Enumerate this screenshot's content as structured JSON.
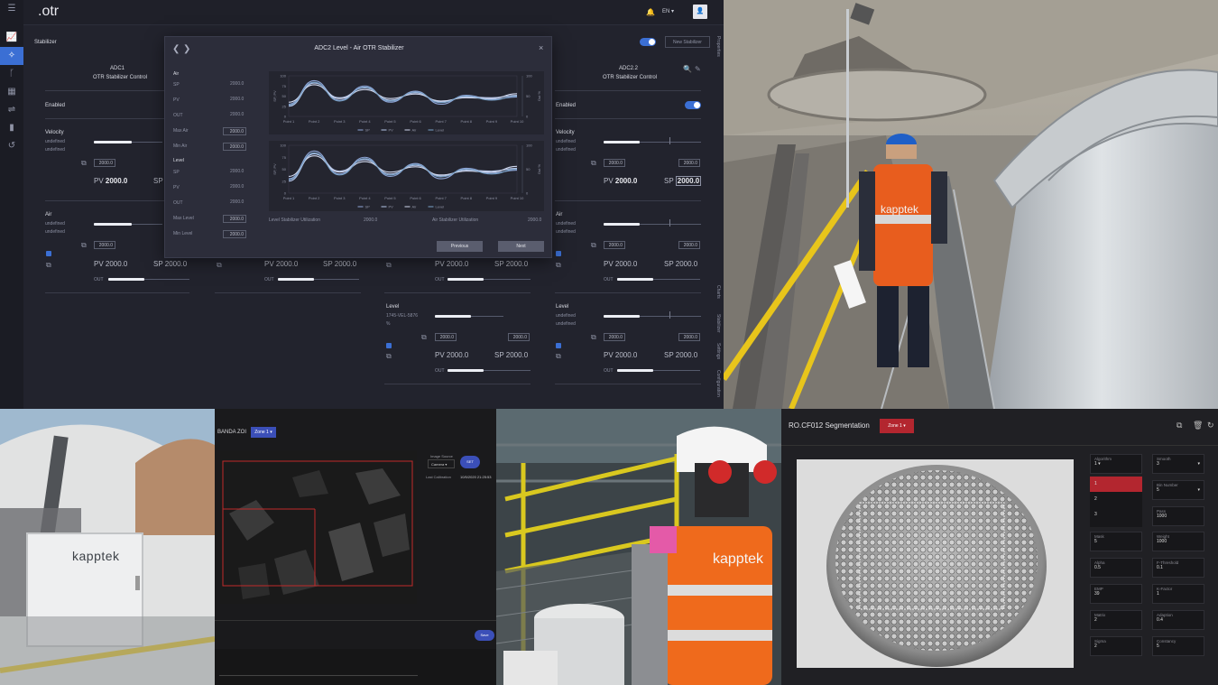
{
  "otr_app": {
    "logo": ".otr",
    "language": "EN",
    "page": "Stabilizer",
    "new_stabilizer_label": "New Stabilizer",
    "side_tabs": [
      "Properties",
      "Charts",
      "Stabilizer",
      "Settings",
      "Configuration"
    ],
    "left_panel": {
      "title": "ADC1",
      "subtitle": "OTR Stabilizer Control",
      "enabled_label": "Enabled",
      "velocity_label": "Velocity",
      "undefined_1": "undefined",
      "undefined_2": "undefined",
      "velocity_box": "2000.0",
      "pv_label": "PV",
      "pv_value": "2000.0",
      "sp_label": "SP",
      "air_label": "Air",
      "air_box": "2000.0",
      "air_pv": "PV 2000.0",
      "air_sp": "SP 2000.0",
      "out_label": "OUT"
    },
    "mid_row": {
      "pv": "PV 2000.0",
      "sp": "SP 2000.0",
      "out_label": "OUT"
    },
    "level_panel": {
      "label": "Level",
      "tag": "1745-VEL-5876",
      "unit": "%",
      "box1": "2000.0",
      "box2": "2000.0",
      "pv": "PV 2000.0",
      "sp": "SP 2000.0",
      "out_label": "OUT"
    },
    "right_panel": {
      "title": "ADC2.2",
      "subtitle": "OTR Stabilizer Control",
      "enabled_label": "Enabled",
      "velocity_label": "Velocity",
      "undefined_1": "undefined",
      "undefined_2": "undefined",
      "box1": "2000.0",
      "box2": "2000.0",
      "pv_label": "PV",
      "pv_value": "2000.0",
      "sp_label": "SP",
      "sp_value": "2000.0",
      "air_label": "Air",
      "air_box1": "2000.0",
      "air_box2": "2000.0",
      "air_pv": "PV 2000.0",
      "air_sp": "SP 2000.0",
      "out_label": "OUT",
      "level_label": "Level",
      "level_box1": "2000.0",
      "level_box2": "2000.0",
      "level_pv": "PV 2000.0",
      "level_sp": "SP 2000.0",
      "level_out": "OUT"
    },
    "modal": {
      "title": "ADC2 Level - Air OTR Stabilizer",
      "air_label": "Air",
      "level_label": "Level",
      "rows_air": [
        {
          "label": "SP",
          "value": "2000.0"
        },
        {
          "label": "PV",
          "value": "2000.0"
        },
        {
          "label": "OUT",
          "value": "2000.0"
        },
        {
          "label": "Max Air",
          "value": "2000.0"
        },
        {
          "label": "Min Air",
          "value": "2000.0"
        }
      ],
      "rows_level": [
        {
          "label": "SP",
          "value": "2000.0"
        },
        {
          "label": "PV",
          "value": "2000.0"
        },
        {
          "label": "OUT",
          "value": "2000.0"
        },
        {
          "label": "Max Level",
          "value": "2000.0"
        },
        {
          "label": "Min Level",
          "value": "2000.0"
        }
      ],
      "level_util_label": "Level Stabilizer Utilization",
      "level_util_value": "2000.0",
      "air_util_label": "Air Stabilizer Utilization",
      "air_util_value": "2000.0",
      "previous_label": "Previous",
      "next_label": "Next"
    }
  },
  "chart_data": [
    {
      "type": "line",
      "x": [
        "Point 1",
        "Point 2",
        "Point 3",
        "Point 4",
        "Point 5",
        "Point 6",
        "Point 7",
        "Point 8",
        "Point 9",
        "Point 10"
      ],
      "ylim": [
        0,
        100
      ],
      "ylabel": "SP, PV",
      "y2label": "Out %",
      "y_ticks": [
        "100",
        "75",
        "50",
        "25",
        "0"
      ],
      "y2_ticks": [
        "100",
        "50",
        "0"
      ],
      "series": [
        {
          "name": "SP",
          "color": "#8fa6d8",
          "values": [
            30,
            88,
            40,
            75,
            35,
            62,
            30,
            52,
            42,
            48
          ]
        },
        {
          "name": "PV",
          "color": "#b6c6ea",
          "values": [
            25,
            82,
            46,
            70,
            40,
            58,
            36,
            48,
            46,
            52
          ]
        },
        {
          "name": "Air",
          "color": "#d0d8ee",
          "values": [
            35,
            78,
            44,
            66,
            44,
            55,
            38,
            46,
            44,
            56
          ]
        },
        {
          "name": "Level",
          "color": "#7aa2c8",
          "values": [
            28,
            84,
            38,
            72,
            38,
            60,
            34,
            50,
            40,
            50
          ]
        }
      ],
      "legend": [
        "SP",
        "PV",
        "Air",
        "Level"
      ]
    },
    {
      "type": "line",
      "x": [
        "Point 1",
        "Point 2",
        "Point 3",
        "Point 4",
        "Point 5",
        "Point 6",
        "Point 7",
        "Point 8",
        "Point 9",
        "Point 10"
      ],
      "ylim": [
        0,
        100
      ],
      "ylabel": "SP, PV",
      "y2label": "Out %",
      "y_ticks": [
        "100",
        "75",
        "50",
        "25",
        "0"
      ],
      "y2_ticks": [
        "100",
        "50",
        "0"
      ],
      "series": [
        {
          "name": "SP",
          "color": "#8fa6d8",
          "values": [
            30,
            88,
            40,
            75,
            35,
            62,
            30,
            52,
            42,
            48
          ]
        },
        {
          "name": "PV",
          "color": "#b6c6ea",
          "values": [
            25,
            82,
            46,
            70,
            40,
            58,
            36,
            48,
            46,
            52
          ]
        },
        {
          "name": "Air",
          "color": "#d0d8ee",
          "values": [
            35,
            78,
            44,
            66,
            44,
            55,
            38,
            46,
            44,
            56
          ]
        },
        {
          "name": "Level",
          "color": "#7aa2c8",
          "values": [
            28,
            84,
            38,
            72,
            38,
            60,
            34,
            50,
            40,
            50
          ]
        }
      ],
      "legend": [
        "SP",
        "PV",
        "Air",
        "Level"
      ]
    }
  ],
  "banda_app": {
    "title": "BANDA ZOI",
    "zone_label": "Zone 1",
    "image_source_label": "Image Source",
    "image_source_value": "Camera",
    "set_label": "SET",
    "last_calibration_label": "Last Calibration",
    "last_calibration_value": "10/5/2020 21:25:53",
    "save_label": "Save"
  },
  "segmentation_app": {
    "title": "RO.CF012 Segmentation",
    "zone_label": "Zone 1",
    "algorithm_label": "Algorithm",
    "algorithm_value": "1",
    "algorithm_options": [
      "1",
      "2",
      "3"
    ],
    "fields": [
      {
        "label": "Smooth",
        "value": "3"
      },
      {
        "label": "Bin Number",
        "value": "5"
      },
      {
        "label": "Pass",
        "value": "1000"
      },
      {
        "label": "Mask",
        "value": "5"
      },
      {
        "label": "Weight",
        "value": "1000"
      },
      {
        "label": "Alpha",
        "value": "0.5"
      },
      {
        "label": "F-Threshold",
        "value": "0.1"
      },
      {
        "label": "EMP",
        "value": "39"
      },
      {
        "label": "K-Factor",
        "value": "1"
      },
      {
        "label": "Matrix",
        "value": "2"
      },
      {
        "label": "Adaption",
        "value": "0.4"
      },
      {
        "label": "Sigma",
        "value": "2"
      },
      {
        "label": "Constancy",
        "value": "5"
      }
    ]
  },
  "photo_text": {
    "vest_brand": "kapptek",
    "box_brand": "kapptek"
  },
  "colors": {
    "accent_blue": "#3b6fd4",
    "panel_bg": "#22232d",
    "vest_orange": "#e85d1e",
    "zone_red": "#b3262f"
  }
}
